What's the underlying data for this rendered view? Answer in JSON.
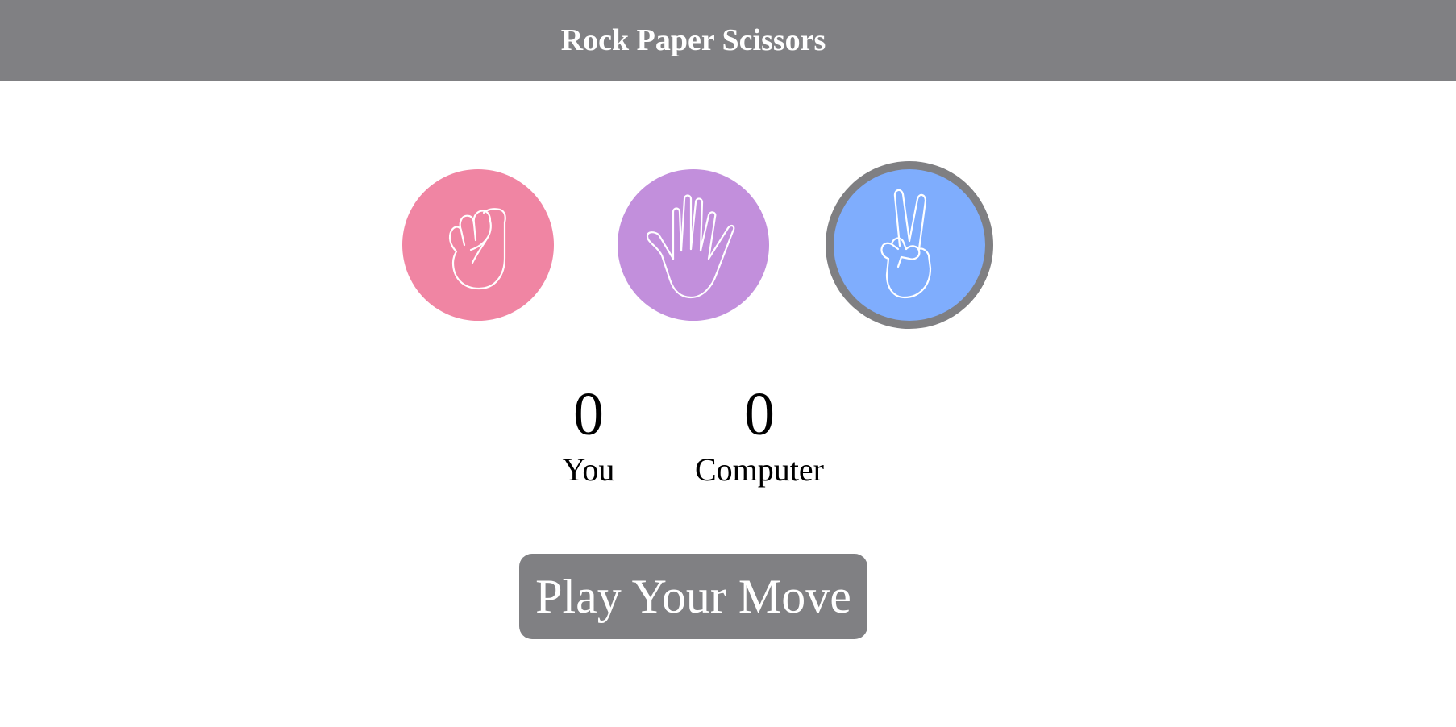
{
  "header": {
    "title": "Rock Paper Scissors"
  },
  "choices": [
    {
      "name": "rock",
      "icon": "fist-icon",
      "color": "#f085a3",
      "selected": false
    },
    {
      "name": "paper",
      "icon": "open-hand-icon",
      "color": "#c28fdc",
      "selected": false
    },
    {
      "name": "scissors",
      "icon": "peace-hand-icon",
      "color": "#7fadfd",
      "selected": true
    }
  ],
  "score": {
    "you_value": "0",
    "you_label": "You",
    "computer_value": "0",
    "computer_label": "Computer"
  },
  "actions": {
    "play_label": "Play Your Move"
  },
  "colors": {
    "header_bg": "#808083",
    "selected_ring": "#7f7f82",
    "button_bg": "#808083"
  }
}
